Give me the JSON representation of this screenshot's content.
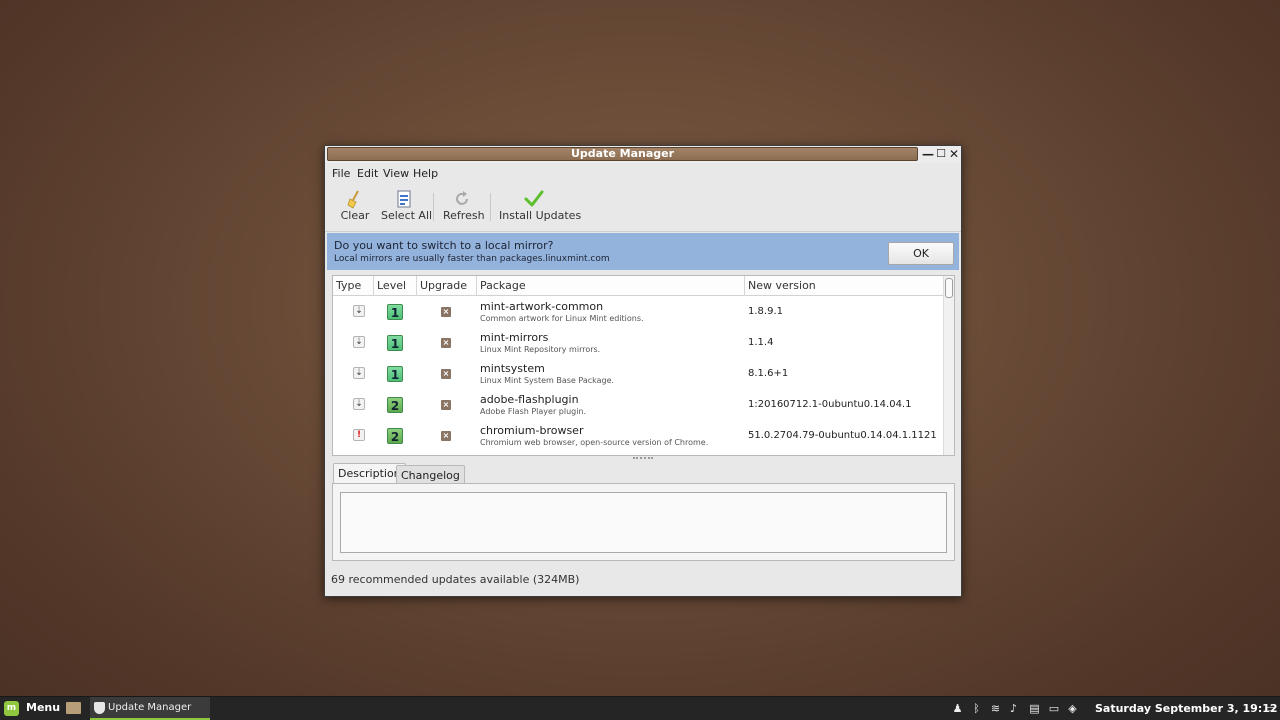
{
  "window": {
    "title": "Update Manager",
    "minimize": "—",
    "maximize": "☐",
    "close": "✕"
  },
  "menubar": [
    "File",
    "Edit",
    "View",
    "Help"
  ],
  "toolbar": {
    "clear": "Clear",
    "select_all": "Select All",
    "refresh": "Refresh",
    "install": "Install Updates"
  },
  "infobar": {
    "title": "Do you want to switch to a local mirror?",
    "subtitle": "Local mirrors are usually faster than packages.linuxmint.com",
    "ok": "OK"
  },
  "table": {
    "columns": [
      "Type",
      "Level",
      "Upgrade",
      "Package",
      "New version"
    ],
    "rows": [
      {
        "type": "⇣",
        "security": false,
        "level": "1",
        "upgrade": "×",
        "package": "mint-artwork-common",
        "description": "Common artwork for Linux Mint editions.",
        "version": "1.8.9.1"
      },
      {
        "type": "⇣",
        "security": false,
        "level": "1",
        "upgrade": "×",
        "package": "mint-mirrors",
        "description": "Linux Mint Repository mirrors.",
        "version": "1.1.4"
      },
      {
        "type": "⇣",
        "security": false,
        "level": "1",
        "upgrade": "×",
        "package": "mintsystem",
        "description": "Linux Mint System Base Package.",
        "version": "8.1.6+1"
      },
      {
        "type": "⇣",
        "security": false,
        "level": "2",
        "upgrade": "×",
        "package": "adobe-flashplugin",
        "description": "Adobe Flash Player plugin.",
        "version": "1:20160712.1-0ubuntu0.14.04.1"
      },
      {
        "type": "!",
        "security": true,
        "level": "2",
        "upgrade": "×",
        "package": "chromium-browser",
        "description": "Chromium web browser, open-source version of Chrome.",
        "version": "51.0.2704.79-0ubuntu0.14.04.1.1121"
      }
    ]
  },
  "tabs": {
    "description": "Description",
    "changelog": "Changelog"
  },
  "status": "69 recommended updates available (324MB)",
  "taskbar": {
    "menu_label": "Menu",
    "task_label": "Update Manager",
    "clock": "Saturday September  3, 19:12"
  }
}
